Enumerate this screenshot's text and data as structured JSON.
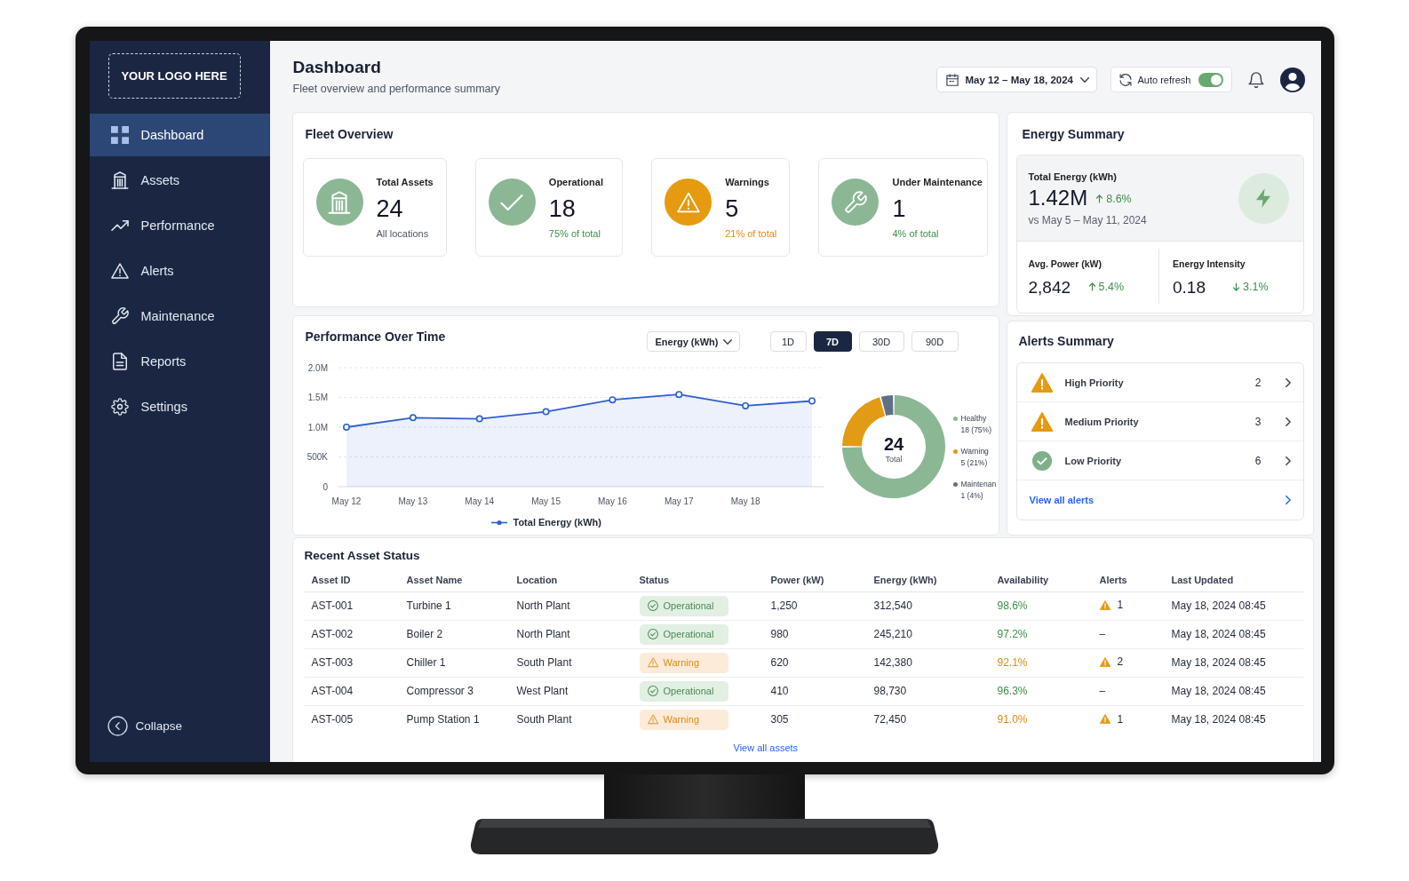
{
  "sidebar": {
    "logo": "YOUR LOGO HERE",
    "items": [
      {
        "label": "Dashboard",
        "selected": true
      },
      {
        "label": "Assets",
        "selected": false
      },
      {
        "label": "Performance",
        "selected": false
      },
      {
        "label": "Alerts",
        "selected": false
      },
      {
        "label": "Maintenance",
        "selected": false
      },
      {
        "label": "Reports",
        "selected": false
      },
      {
        "label": "Settings",
        "selected": false
      }
    ],
    "collapse": "Collapse"
  },
  "header": {
    "title": "Dashboard",
    "subtitle": "Fleet overview and performance summary",
    "date_range": "May 12 – May 18, 2024",
    "auto_refresh": {
      "label": "Auto refresh",
      "on": true
    }
  },
  "fleet_overview": {
    "title": "Fleet Overview",
    "stats": [
      {
        "label": "Total Assets",
        "value": "24",
        "color": "#8cb795",
        "note": {
          "text": "All locations",
          "color": "#4b5563"
        }
      },
      {
        "label": "Operational",
        "value": "18",
        "color": "#8cb795",
        "note": {
          "text": "75% of total",
          "color": "#3e8e4b"
        }
      },
      {
        "label": "Warnings",
        "value": "5",
        "color": "#e59a0f",
        "note": {
          "text": "21% of total",
          "color": "#e08a0c"
        }
      },
      {
        "label": "Under Maintenance",
        "value": "1",
        "color": "#8cb795",
        "note": {
          "text": "4% of total",
          "color": "#3e8e4b"
        }
      }
    ]
  },
  "energy_summary": {
    "title": "Energy Summary",
    "total": {
      "label": "Total Energy (kWh)",
      "value": "1.42M",
      "change": "8.6%",
      "rising": true,
      "comparison": "vs May 5 – May 11, 2024"
    },
    "metrics": [
      {
        "label": "Avg. Power (kW)",
        "value": "2,842",
        "change": "5.4%",
        "rising": true
      },
      {
        "label": "Energy Intensity",
        "value": "0.18",
        "change": "3.1%",
        "rising": false
      }
    ]
  },
  "performance": {
    "title": "Performance Over Time",
    "metric": "Energy (kWh)",
    "ranges": [
      {
        "label": "1D",
        "selected": false
      },
      {
        "label": "7D",
        "selected": true
      },
      {
        "label": "30D",
        "selected": false
      },
      {
        "label": "90D",
        "selected": false
      }
    ],
    "donut_center": {
      "value": "24",
      "label": "Total"
    },
    "chart_data": [
      {
        "type": "area",
        "categories": [
          "May 12",
          "May 13",
          "May 14",
          "May 15",
          "May 16",
          "May 17",
          "May 18",
          null
        ],
        "series": [
          {
            "name": "Total Energy (kWh)",
            "color": "#2f5fd0",
            "values": [
              1000000,
              1160000,
              1140000,
              1260000,
              1460000,
              1550000,
              1360000,
              1440000
            ]
          }
        ],
        "ylim": [
          0,
          2000000
        ],
        "yticks": [
          {
            "value": 0,
            "label": "0"
          },
          {
            "value": 500000,
            "label": "500K"
          },
          {
            "value": 1000000,
            "label": "1.0M"
          },
          {
            "value": 1500000,
            "label": "1.5M"
          },
          {
            "value": 2000000,
            "label": "2.0M"
          }
        ],
        "marker": "circle",
        "grid": true,
        "legend": "bottom"
      },
      {
        "type": "donut",
        "categories": [
          "Healthy",
          "Warning",
          "Maintenan"
        ],
        "values": [
          18,
          5,
          1
        ],
        "colors": [
          "#8cb795",
          "#e39a14",
          "#5f7086"
        ],
        "value_labels": [
          "18 (75%)",
          "5 (21%)",
          "1 (4%)"
        ],
        "legend": "right"
      }
    ]
  },
  "alerts_summary": {
    "title": "Alerts Summary",
    "items": [
      {
        "kind": "warning",
        "label": "High Priority",
        "count": "2"
      },
      {
        "kind": "warning",
        "label": "Medium Priority",
        "count": "3"
      },
      {
        "kind": "ok",
        "label": "Low Priority",
        "count": "6"
      }
    ],
    "link": "View all alerts"
  },
  "recent_assets": {
    "title": "Recent Asset Status",
    "columns": [
      "Asset ID",
      "Asset Name",
      "Location",
      "Status",
      "Power (kW)",
      "Energy (kWh)",
      "Availability",
      "Alerts",
      "Last Updated"
    ],
    "rows": [
      {
        "id": "AST-001",
        "name": "Turbine 1",
        "location": "North Plant",
        "status": {
          "kind": "operational",
          "label": "Operational"
        },
        "power": "1,250",
        "energy": "312,540",
        "availability": "98.6%",
        "alert_flag": true,
        "alerts": "1",
        "updated": "May 18, 2024 08:45"
      },
      {
        "id": "AST-002",
        "name": "Boiler 2",
        "location": "North Plant",
        "status": {
          "kind": "operational",
          "label": "Operational"
        },
        "power": "980",
        "energy": "245,210",
        "availability": "97.2%",
        "alert_flag": false,
        "alerts": "–",
        "updated": "May 18, 2024 08:45"
      },
      {
        "id": "AST-003",
        "name": "Chiller 1",
        "location": "South Plant",
        "status": {
          "kind": "warning",
          "label": "Warning"
        },
        "power": "620",
        "energy": "142,380",
        "availability": "92.1%",
        "alert_flag": true,
        "alerts": "2",
        "updated": "May 18, 2024 08:45"
      },
      {
        "id": "AST-004",
        "name": "Compressor 3",
        "location": "West Plant",
        "status": {
          "kind": "operational",
          "label": "Operational"
        },
        "power": "410",
        "energy": "98,730",
        "availability": "96.3%",
        "alert_flag": false,
        "alerts": "–",
        "updated": "May 18, 2024 08:45"
      },
      {
        "id": "AST-005",
        "name": "Pump Station 1",
        "location": "South Plant",
        "status": {
          "kind": "warning",
          "label": "Warning"
        },
        "power": "305",
        "energy": "72,450",
        "availability": "91.0%",
        "alert_flag": true,
        "alerts": "1",
        "updated": "May 18, 2024 08:45"
      }
    ],
    "link": "View all assets"
  }
}
